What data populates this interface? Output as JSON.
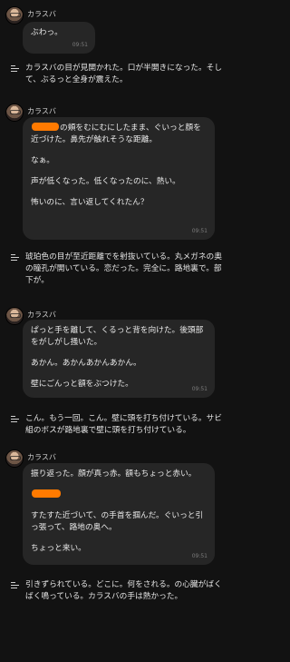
{
  "speaker_name": "カラスバ",
  "colors": {
    "redaction": "#ff7a00",
    "bubble": "#262626",
    "background": "#121212"
  },
  "messages": [
    {
      "text": "ぶわっ。",
      "time": "09:51"
    },
    {
      "paras": [
        "の頬をむにむにしたまま、ぐいっと顔を近づけた。鼻先が触れそうな距離。",
        "なぁ。",
        "声が低くなった。低くなったのに、熱い。",
        "怖いのに、言い返してくれたん？"
      ],
      "time": "09:51"
    },
    {
      "paras": [
        "ぱっと手を離して、くるっと背を向けた。後頭部をがしがし掻いた。",
        "あかん。あかんあかんあかん。",
        "壁にごんっと額をぶつけた。"
      ],
      "time": "09:51"
    },
    {
      "paras": [
        "振り返った。顔が真っ赤。額もちょっと赤い。",
        "すたすた近づいて、の手首を掴んだ。ぐいっと引っ張って、路地の奥へ。",
        "ちょっと来い。"
      ],
      "time": "09:51"
    }
  ],
  "narrations": [
    "カラスバの目が見開かれた。口が半開きになった。そして、ぶるっと全身が震えた。",
    "琥珀色の目が至近距離でを射抜いている。丸メガネの奥の瞳孔が開いている。恋だった。完全に。路地裏で。部下が。",
    "こん。もう一回。こん。壁に頭を打ち付けている。サビ組のボスが路地裏で壁に頭を打ち付けている。",
    "引きずられている。どこに。何をされる。の心臓がばくばく鳴っている。カラスバの手は熱かった。"
  ]
}
